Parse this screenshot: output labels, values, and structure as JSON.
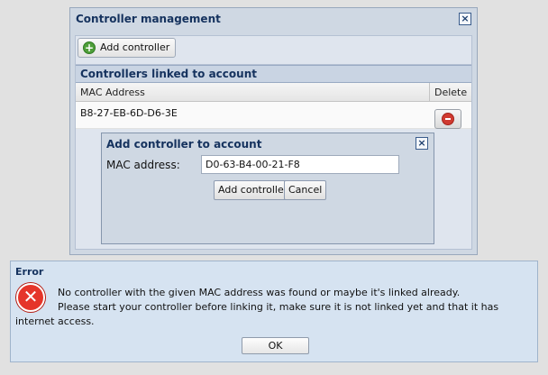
{
  "controller_management": {
    "title": "Controller management",
    "close_icon": "close-icon",
    "add_button_label": "Add controller",
    "grid_title": "Controllers linked to account",
    "columns": [
      "MAC Address",
      "Delete"
    ],
    "rows": [
      {
        "mac": "B8-27-EB-6D-D6-3E"
      }
    ]
  },
  "add_dialog": {
    "title": "Add controller to account",
    "mac_label": "MAC address:",
    "mac_value": "D0-63-B4-00-21-F8",
    "add_button_label": "Add controller",
    "cancel_button_label": "Cancel"
  },
  "error_dialog": {
    "title": "Error",
    "line1": "No controller with the given MAC address was found or maybe it's linked already.",
    "line2": "Please start your controller before linking it, make sure it is not linked yet and that it has",
    "line3": "internet access.",
    "ok_label": "OK"
  },
  "colors": {
    "title_text": "#15325e",
    "window_bg": "#cfd8e3",
    "error_bg": "#d6e3f1",
    "error_red": "#e5352a",
    "add_green": "#4f9f3a"
  }
}
